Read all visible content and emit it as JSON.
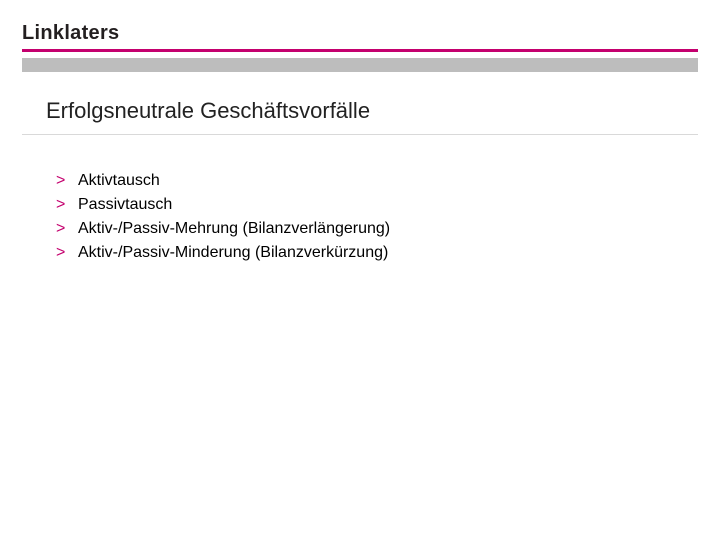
{
  "brand": "Linklaters",
  "title": "Erfolgsneutrale Geschäftsvorfälle",
  "bullet_glyph": ">",
  "items": [
    "Aktivtausch",
    "Passivtausch",
    "Aktiv-/Passiv-Mehrung (Bilanzverlängerung)",
    "Aktiv-/Passiv-Minderung (Bilanzverkürzung)"
  ],
  "colors": {
    "accent": "#c4006e",
    "grey_bar": "#bdbdbd",
    "title_rule": "#d9d9d9"
  }
}
